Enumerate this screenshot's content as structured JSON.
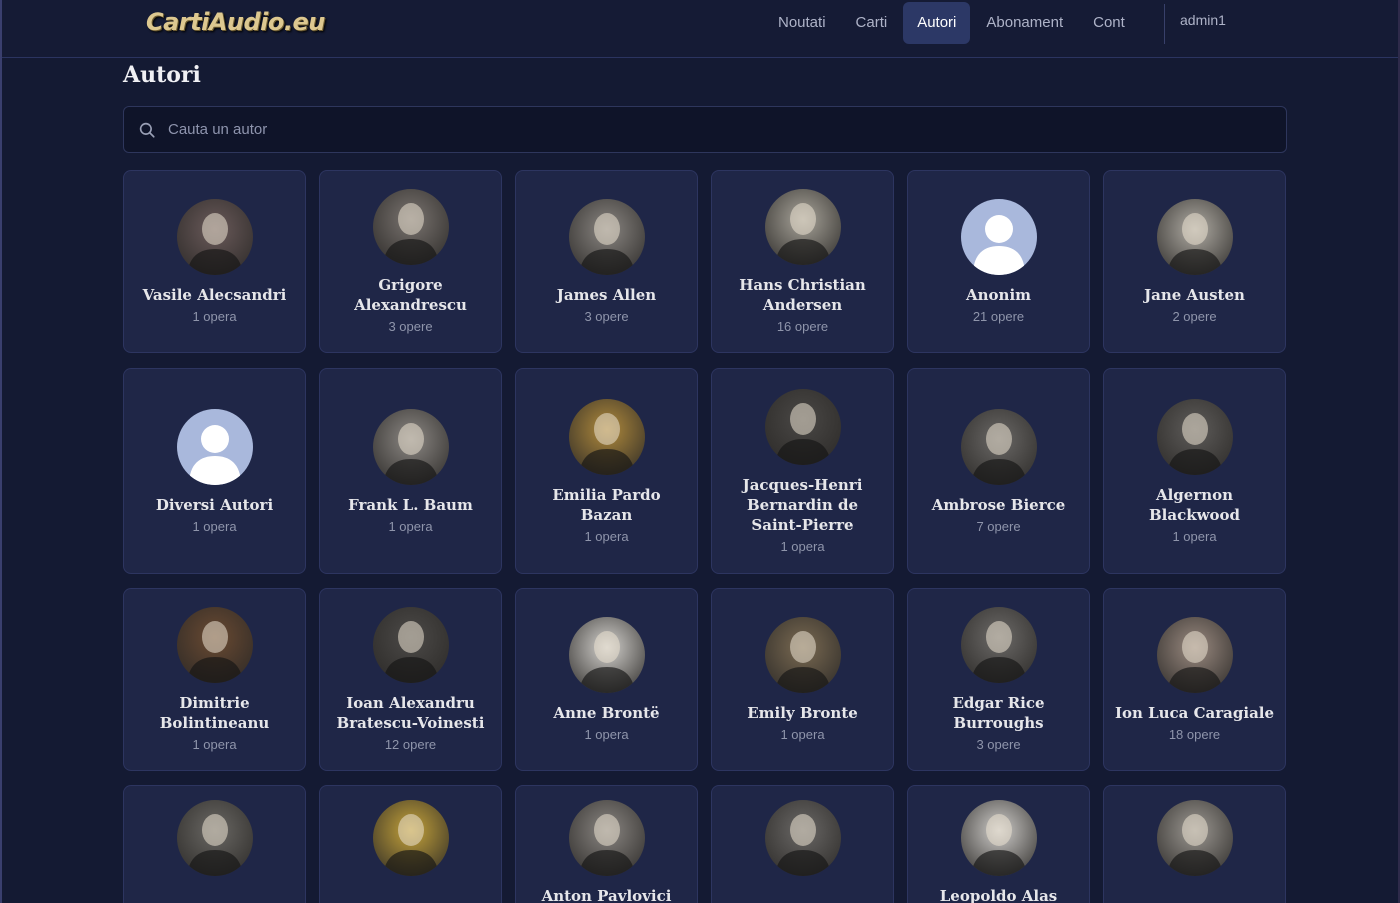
{
  "header": {
    "logo": "CartiAudio.eu",
    "nav": [
      {
        "label": "Noutati",
        "active": false
      },
      {
        "label": "Carti",
        "active": false
      },
      {
        "label": "Autori",
        "active": true
      },
      {
        "label": "Abonament",
        "active": false
      },
      {
        "label": "Cont",
        "active": false
      }
    ],
    "user": "admin1"
  },
  "page": {
    "title": "Autori",
    "search_placeholder": "Cauta un autor"
  },
  "authors": [
    {
      "name": "Vasile Alecsandri",
      "count": "1 opera",
      "portrait": "portrait-photo",
      "tone": "#6a5a5a"
    },
    {
      "name": "Grigore Alexandrescu",
      "count": "3 opere",
      "portrait": "portrait-photo",
      "tone": "#7a7470"
    },
    {
      "name": "James Allen",
      "count": "3 opere",
      "portrait": "portrait-photo",
      "tone": "#8a8682"
    },
    {
      "name": "Hans Christian Andersen",
      "count": "16 opere",
      "portrait": "portrait-photo",
      "tone": "#a8a49a"
    },
    {
      "name": "Anonim",
      "count": "21 opere",
      "portrait": "placeholder",
      "tone": "#a9b8dc"
    },
    {
      "name": "Jane Austen",
      "count": "2 opere",
      "portrait": "portrait-photo",
      "tone": "#b0aca4"
    },
    {
      "name": "Diversi Autori",
      "count": "1 opera",
      "portrait": "placeholder",
      "tone": "#a9b8dc"
    },
    {
      "name": "Frank L. Baum",
      "count": "1 opera",
      "portrait": "portrait-photo",
      "tone": "#8c8884"
    },
    {
      "name": "Emilia Pardo Bazan",
      "count": "1 opera",
      "portrait": "portrait-photo",
      "tone": "#b08a3c"
    },
    {
      "name": "Jacques-Henri Bernardin de Saint-Pierre",
      "count": "1 opera",
      "portrait": "portrait-photo",
      "tone": "#4a4846"
    },
    {
      "name": "Ambrose Bierce",
      "count": "7 opere",
      "portrait": "portrait-photo",
      "tone": "#6a6866"
    },
    {
      "name": "Algernon Blackwood",
      "count": "1 opera",
      "portrait": "portrait-photo",
      "tone": "#5e5c5a"
    },
    {
      "name": "Dimitrie Bolintineanu",
      "count": "1 opera",
      "portrait": "portrait-photo",
      "tone": "#6a4a32"
    },
    {
      "name": "Ioan Alexandru Bratescu-Voinesti",
      "count": "12 opere",
      "portrait": "portrait-photo",
      "tone": "#4c4a48"
    },
    {
      "name": "Anne Brontë",
      "count": "1 opera",
      "portrait": "portrait-photo",
      "tone": "#d4d2ce"
    },
    {
      "name": "Emily Bronte",
      "count": "1 opera",
      "portrait": "portrait-photo",
      "tone": "#7a6a52"
    },
    {
      "name": "Edgar Rice Burroughs",
      "count": "3 opere",
      "portrait": "portrait-photo",
      "tone": "#6c6a68"
    },
    {
      "name": "Ion Luca Caragiale",
      "count": "18 opere",
      "portrait": "portrait-photo",
      "tone": "#9a8a80"
    },
    {
      "name": "",
      "count": "",
      "portrait": "portrait-photo",
      "tone": "#6a6864"
    },
    {
      "name": "",
      "count": "",
      "portrait": "icon-painting",
      "tone": "#c4a23a"
    },
    {
      "name": "Anton Pavlovici",
      "count": "",
      "portrait": "portrait-photo",
      "tone": "#8a8682"
    },
    {
      "name": "",
      "count": "",
      "portrait": "portrait-photo",
      "tone": "#6a6866"
    },
    {
      "name": "Leopoldo Alas",
      "count": "",
      "portrait": "portrait-photo",
      "tone": "#cfcdca"
    },
    {
      "name": "",
      "count": "",
      "portrait": "portrait-photo",
      "tone": "#9c9892"
    }
  ]
}
